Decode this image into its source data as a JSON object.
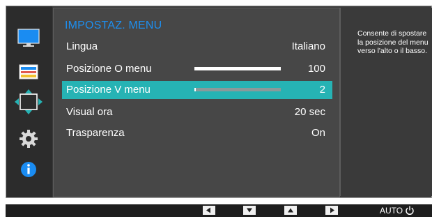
{
  "colors": {
    "title_blue": "#1d8ff0",
    "selected_row": "#26b3b4",
    "info_icon_blue": "#1a8cf2"
  },
  "sidebar": {
    "items": [
      {
        "icon": "monitor-icon",
        "selected": false
      },
      {
        "icon": "color-bars-icon",
        "selected": false
      },
      {
        "icon": "position-arrows-icon",
        "selected": true
      },
      {
        "icon": "gear-icon",
        "selected": false
      },
      {
        "icon": "info-icon",
        "selected": false
      }
    ]
  },
  "menu": {
    "title": "IMPOSTAZ. MENU",
    "rows": [
      {
        "label": "Lingua",
        "value": "Italiano",
        "selected": false
      },
      {
        "label": "Posizione O menu",
        "value": "100",
        "progress": 1.0,
        "selected": false
      },
      {
        "label": "Posizione V menu",
        "value": "2",
        "progress": 0.02,
        "selected": true
      },
      {
        "label": "Visual ora",
        "value": "20 sec",
        "selected": false
      },
      {
        "label": "Trasparenza",
        "value": "On",
        "selected": false
      }
    ]
  },
  "help": {
    "text": "Consente di spostare\nla posizione del menu\nverso l'alto o il basso."
  },
  "bottom_bar": {
    "buttons": [
      "left-arrow-button-icon",
      "down-arrow-button-icon",
      "up-arrow-button-icon",
      "right-arrow-button-icon"
    ],
    "auto_label": "AUTO",
    "power_icon": "power-icon"
  }
}
